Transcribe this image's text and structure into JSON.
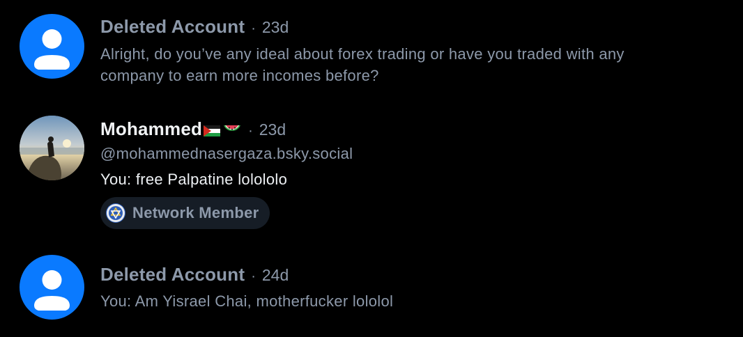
{
  "conversations": [
    {
      "name": "Deleted Account",
      "separator": "·",
      "time": "23d",
      "message": "Alright, do you’ve any ideal about forex trading or have you traded with any company to earn more incomes before?",
      "avatar": "default-user-icon"
    },
    {
      "name": "Mohammed",
      "name_emoji": [
        "palestine-flag-icon",
        "watermelon-icon"
      ],
      "separator": "·",
      "time": "23d",
      "handle": "@mohammednasergaza.bsky.social",
      "message": "You: free Palpatine lolololo",
      "badge": {
        "label": "Network Member",
        "icon": "network-member-icon"
      },
      "avatar": "profile-photo"
    },
    {
      "name": "Deleted Account",
      "separator": "·",
      "time": "24d",
      "message": "You: Am Yisrael Chai, motherfucker lololol",
      "avatar": "default-user-icon"
    }
  ],
  "colors": {
    "background": "#000000",
    "muted_text": "#8d99aa",
    "active_text": "#f1f3f5",
    "avatar_blue": "#0a7aff",
    "badge_background": "#161d26"
  }
}
